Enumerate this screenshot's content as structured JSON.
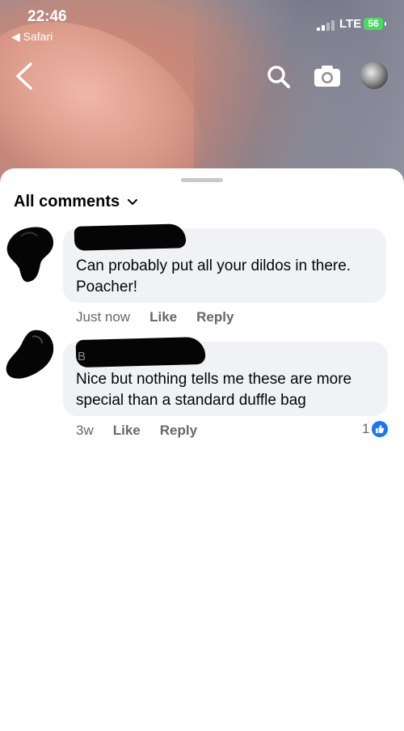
{
  "status_bar": {
    "time": "22:46",
    "back_app": "◀ Safari",
    "network": "LTE",
    "battery": "56",
    "battery_color": "#4cd964"
  },
  "top_bar": {
    "icons": [
      "back-chevron-icon",
      "search-icon",
      "camera-icon",
      "profile-avatar"
    ]
  },
  "sheet": {
    "filter_label": "All comments",
    "filter_icon": "chevron-down-icon"
  },
  "comments": [
    {
      "name_hint": "",
      "text": "Can probably put all your dildos in there.\nPoacher!",
      "time": "Just now",
      "like": "Like",
      "reply": "Reply"
    },
    {
      "name_hint": "B",
      "text": "Nice but nothing tells me these are more\nspecial than a standard duffle bag",
      "time": "3w",
      "like": "Like",
      "reply": "Reply",
      "reaction_count": "1",
      "reaction_icon": "thumbs-up-icon",
      "reaction_color": "#1877f2"
    }
  ]
}
